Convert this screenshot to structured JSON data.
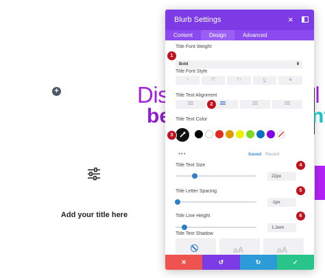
{
  "background": {
    "hero_line1_left": "Dis",
    "hero_line1_right": "ll",
    "hero_line2_left": "be",
    "hero_line2_right": "nt",
    "add_title": "Add your title here",
    "add_symbol": "+"
  },
  "panel": {
    "title": "Blurb Settings",
    "close_symbol": "×",
    "tabs": [
      {
        "label": "Content",
        "active": false
      },
      {
        "label": "Design",
        "active": true
      },
      {
        "label": "Advanced",
        "active": false
      }
    ],
    "font_weight": {
      "label": "Title Font Weight",
      "value": "Bold",
      "arrow": "⬍"
    },
    "font_style": {
      "label": "Title Font Style",
      "buttons": [
        "I",
        "TT",
        "Tт",
        "U",
        "S"
      ]
    },
    "text_alignment": {
      "label": "Title Text Alignment"
    },
    "text_color": {
      "label": "Title Text Color",
      "swatches": [
        "#000000",
        "#ffffff",
        "#e02b20",
        "#e09900",
        "#edf000",
        "#7cda24",
        "#0c71c3",
        "#8300e9"
      ],
      "dots": "•••",
      "saved": "Saved",
      "recent": "Recent"
    },
    "text_size": {
      "label": "Title Text Size",
      "value": "22px",
      "slider_fraction": 0.22
    },
    "letter_spacing": {
      "label": "Title Letter Spacing",
      "value": "-1px",
      "slider_fraction": 0.2
    },
    "line_height": {
      "label": "Title Line Height",
      "value": "1.2em",
      "slider_fraction": 0.1
    },
    "text_shadow": {
      "label": "Title Text Shadow",
      "preview_text": "aA"
    },
    "footer": [
      {
        "symbol": "✕",
        "color": "#ef5350"
      },
      {
        "symbol": "↺",
        "color": "#7d3be5"
      },
      {
        "symbol": "↻",
        "color": "#2e9bd9"
      },
      {
        "symbol": "✓",
        "color": "#29c48a"
      }
    ]
  },
  "badges": [
    "1",
    "2",
    "3",
    "4",
    "5",
    "6"
  ],
  "colors": {
    "accent": "#7d3be5",
    "badge": "#c1121f",
    "slider_knob": "#2e7fc8"
  }
}
